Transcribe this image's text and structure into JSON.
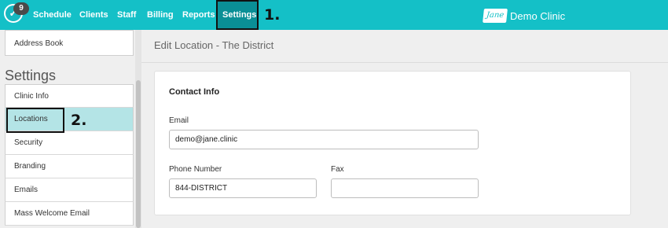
{
  "nav": {
    "badge_count": "9",
    "items": [
      {
        "label": "Schedule"
      },
      {
        "label": "Clients"
      },
      {
        "label": "Staff"
      },
      {
        "label": "Billing"
      },
      {
        "label": "Reports"
      },
      {
        "label": "Settings",
        "active": true
      }
    ],
    "brand_logo": "Jane",
    "brand_name": "Demo Clinic",
    "step_one": "1."
  },
  "sidebar": {
    "address_book": "Address Book",
    "heading": "Settings",
    "items": [
      {
        "label": "Clinic Info"
      },
      {
        "label": "Locations",
        "selected": true
      },
      {
        "label": "Security"
      },
      {
        "label": "Branding"
      },
      {
        "label": "Emails"
      },
      {
        "label": "Mass Welcome Email"
      }
    ],
    "step_two": "2."
  },
  "main": {
    "title": "Edit Location - The District",
    "card_title": "Contact Info",
    "email_label": "Email",
    "email_value": "demo@jane.clinic",
    "phone_label": "Phone Number",
    "phone_value": "844-DISTRICT",
    "fax_label": "Fax",
    "fax_value": ""
  },
  "colors": {
    "accent": "#14c0c7",
    "selected_row": "#b4e4e6",
    "active_tab": "#0a8f96"
  }
}
